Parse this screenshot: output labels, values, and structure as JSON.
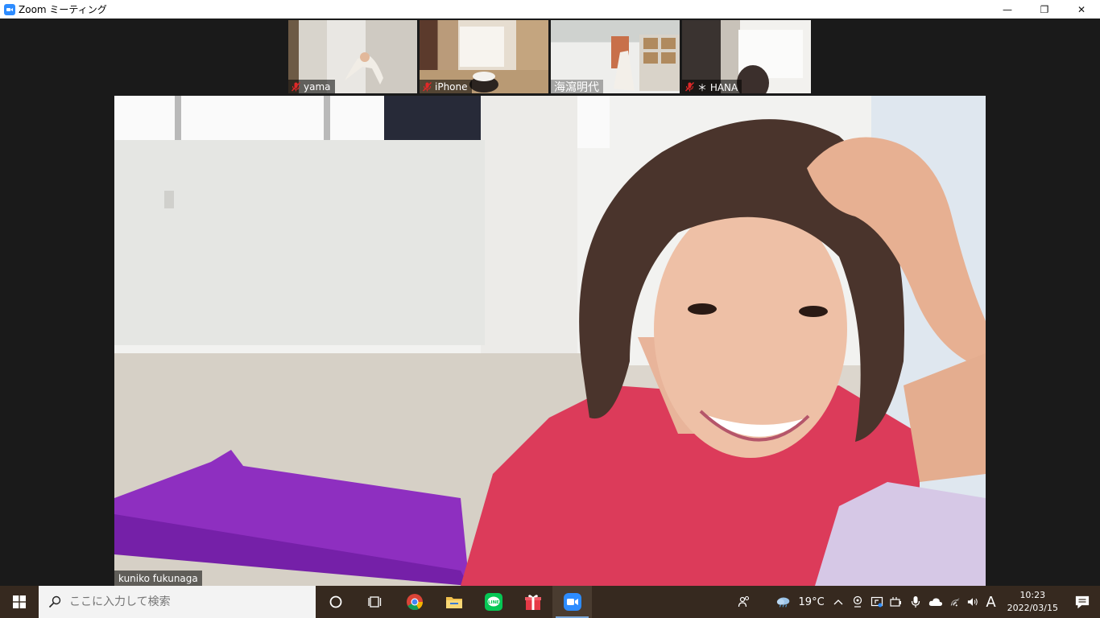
{
  "window": {
    "title": "Zoom ミーティング",
    "controls": {
      "minimize": "—",
      "restore": "❐",
      "close": "✕"
    }
  },
  "participants": [
    {
      "name": "yama",
      "muted": true
    },
    {
      "name": "iPhone",
      "muted": true
    },
    {
      "name": "海瀉明代",
      "muted": false
    },
    {
      "name": "＊ HANA",
      "muted": true
    }
  ],
  "active_speaker": {
    "name": "kuniko fukunaga"
  },
  "taskbar": {
    "search_placeholder": "ここに入力して検索",
    "apps": [
      "cortana",
      "task-view",
      "chrome",
      "file-explorer",
      "line",
      "gift",
      "zoom"
    ],
    "tray": {
      "temperature": "19°C",
      "ime": "A"
    },
    "clock": {
      "time": "10:23",
      "date": "2022/03/15"
    }
  },
  "colors": {
    "zoom_blue": "#2d8cff",
    "taskbar_bg": "#36291f",
    "meeting_bg": "#1a1a1a",
    "muted_red": "#e02828"
  }
}
